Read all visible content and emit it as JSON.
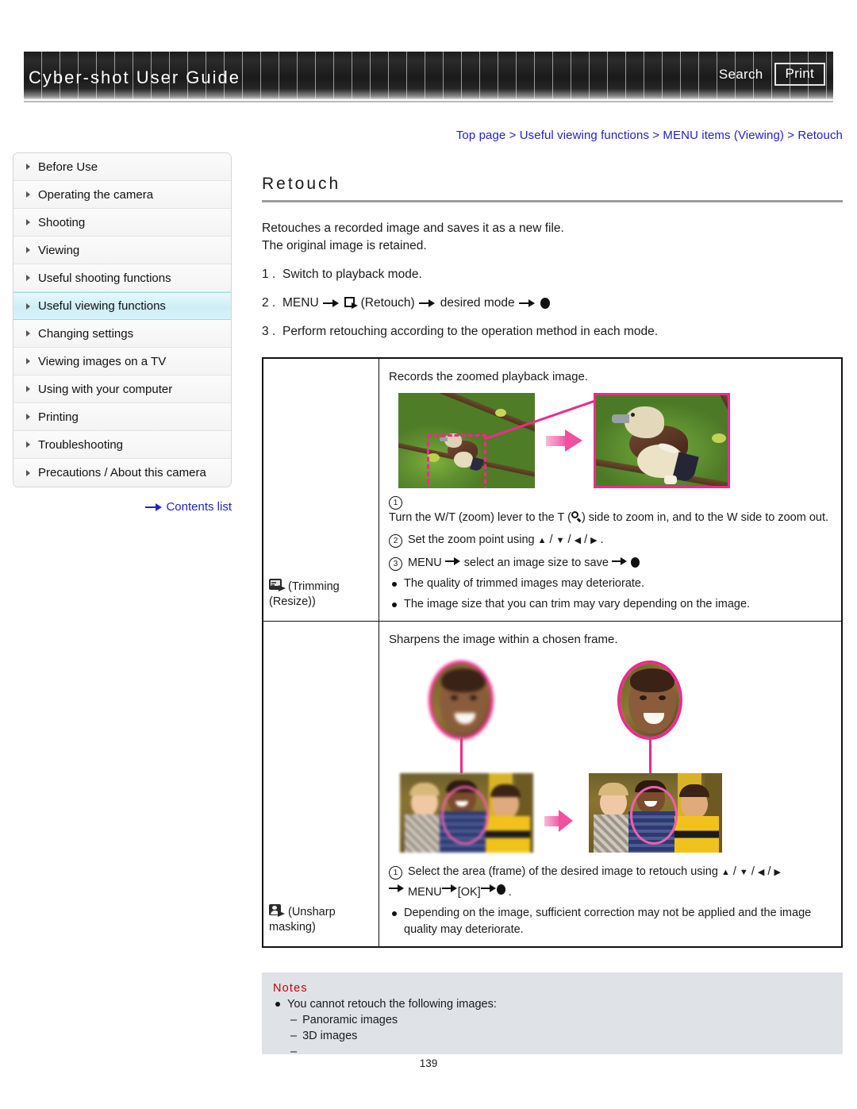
{
  "header": {
    "title": "Cyber-shot User Guide",
    "search_label": "Search",
    "print_label": "Print"
  },
  "breadcrumb": {
    "text": "Top page > Useful viewing functions > MENU items (Viewing) > Retouch"
  },
  "sidebar": {
    "items": [
      {
        "label": "Before Use",
        "active": false
      },
      {
        "label": "Operating the camera",
        "active": false
      },
      {
        "label": "Shooting",
        "active": false
      },
      {
        "label": "Viewing",
        "active": false
      },
      {
        "label": "Useful shooting functions",
        "active": false
      },
      {
        "label": "Useful viewing functions",
        "active": true
      },
      {
        "label": "Changing settings",
        "active": false
      },
      {
        "label": "Viewing images on a TV",
        "active": false
      },
      {
        "label": "Using with your computer",
        "active": false
      },
      {
        "label": "Printing",
        "active": false
      },
      {
        "label": "Troubleshooting",
        "active": false
      },
      {
        "label": "Precautions / About this camera",
        "active": false
      }
    ],
    "contents_list_label": "Contents list"
  },
  "main": {
    "title": "Retouch",
    "intro_line1": "Retouches a recorded image and saves it as a new file.",
    "intro_line2": "The original image is retained.",
    "steps": {
      "n1": "1 .",
      "s1": "Switch to playback mode.",
      "n2": "2 .",
      "s2_a": "MENU",
      "s2_b": "(Retouch)",
      "s2_c": "desired mode",
      "n3": "3 .",
      "s3": "Perform retouching according to the operation method in each mode."
    }
  },
  "table": {
    "rows": [
      {
        "mode_label_a": "(Trimming",
        "mode_label_b": "(Resize))",
        "description": "Records the zoomed playback image.",
        "substeps": [
          {
            "num": "1",
            "text_a": "Turn the W/T (zoom) lever to the T (",
            "text_b": ") side to zoom in, and to the W side to zoom out."
          },
          {
            "num": "2",
            "text_a": "Set the zoom point using",
            "text_b": "."
          },
          {
            "num": "3",
            "text_a": "MENU",
            "text_b": "select an image size to save"
          }
        ],
        "bullets": [
          "The quality of trimmed images may deteriorate.",
          "The image size that you can trim may vary depending on the image."
        ]
      },
      {
        "mode_label_a": "(Unsharp",
        "mode_label_b": "masking)",
        "description": "Sharpens the image within a chosen frame.",
        "substeps": [
          {
            "num": "1",
            "text_a": "Select the area (frame) of the desired image to retouch using",
            "text_b": ""
          },
          {
            "num": "",
            "text_a": "MENU",
            "text_b": "[OK]"
          }
        ],
        "bullets": [
          "Depending on the image, sufficient correction may not be applied and the image quality may deteriorate."
        ]
      }
    ]
  },
  "notes": {
    "title": "Notes",
    "items": [
      "You cannot retouch the following images:"
    ],
    "sub_items": [
      "Panoramic images",
      "3D images",
      ""
    ]
  },
  "footer": {
    "page_number": "139"
  },
  "colors": {
    "link": "#2222cc",
    "notes_title": "#cc0000",
    "notes_bg": "#dfe3e8",
    "accent_pink": "#ee2a8c",
    "sidebar_active": "#cdeef6"
  }
}
